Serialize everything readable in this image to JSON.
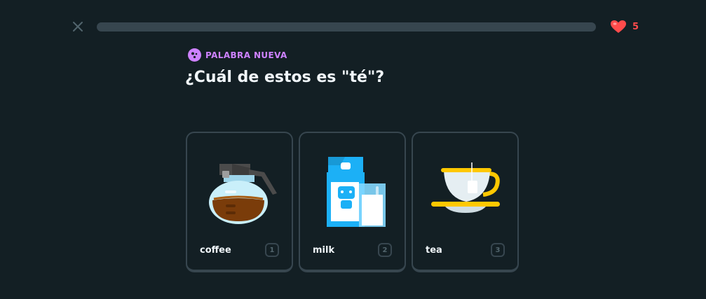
{
  "header": {
    "close_icon": "close-icon",
    "progress": 0.0,
    "hearts": "5",
    "heart_icon": "heart-icon"
  },
  "prompt": {
    "badge_icon": "new-word-icon",
    "badge_label": "PALABRA NUEVA",
    "question": "¿Cuál de estos es \"té\"?"
  },
  "choices": [
    {
      "label": "coffee",
      "key": "1",
      "image": "coffee-pot"
    },
    {
      "label": "milk",
      "key": "2",
      "image": "milk-carton-and-glass"
    },
    {
      "label": "tea",
      "key": "3",
      "image": "tea-cup-with-teabag"
    }
  ],
  "colors": {
    "background": "#131f24",
    "border": "#37464f",
    "heart": "#ff4b4b",
    "badge": "#ce82ff",
    "text": "#f1f7fb"
  }
}
